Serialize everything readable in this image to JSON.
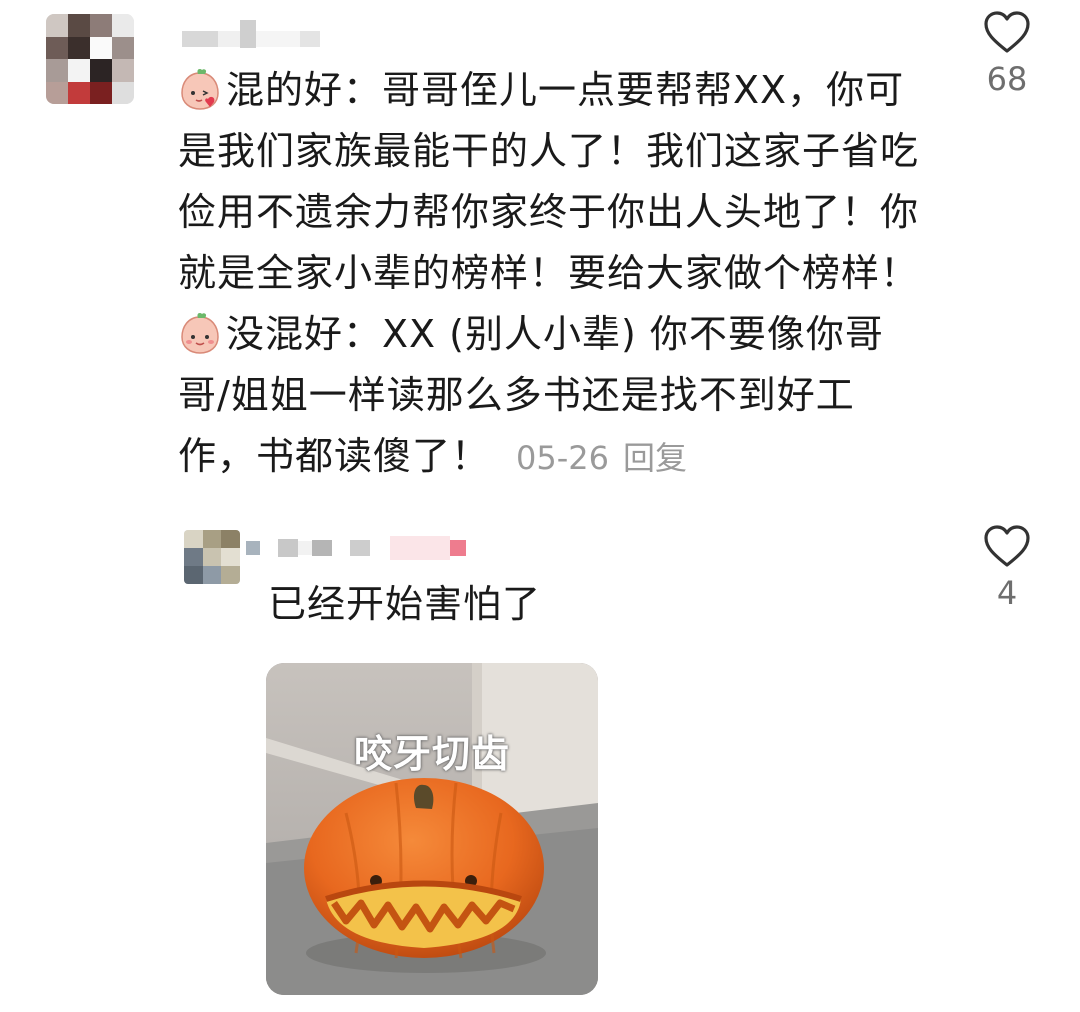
{
  "comments": [
    {
      "lines": [
        {
          "prefix": "混的好：",
          "text": "哥哥侄儿一点要帮帮XX，你可"
        },
        {
          "text": "是我们家族最能干的人了！我们这家子省吃"
        },
        {
          "text": "俭用不遗余力帮你家终于你出人头地了！你"
        },
        {
          "text": "就是全家小辈的榜样！要给大家做个榜样！"
        },
        {
          "prefix": "没混好：",
          "text": "XX (别人小辈) 你不要像你哥"
        },
        {
          "text": "哥/姐姐一样读那么多书还是找不到好工"
        },
        {
          "text": "作，书都读傻了！"
        }
      ],
      "date": "05-26",
      "reply_label": "回复",
      "likes": "68"
    },
    {
      "text": "已经开始害怕了",
      "likes": "4",
      "sticker_caption": "咬牙切齿"
    }
  ],
  "icons": {
    "like": "heart-outline-icon",
    "emoji_1": "blushing-peach-emoji-icon",
    "emoji_2": "smiling-peach-emoji-icon"
  },
  "colors": {
    "text": "#1a1a1a",
    "meta": "#9a9a9a",
    "like_count": "#6e6e6e",
    "pumpkin": "#e8681f"
  }
}
